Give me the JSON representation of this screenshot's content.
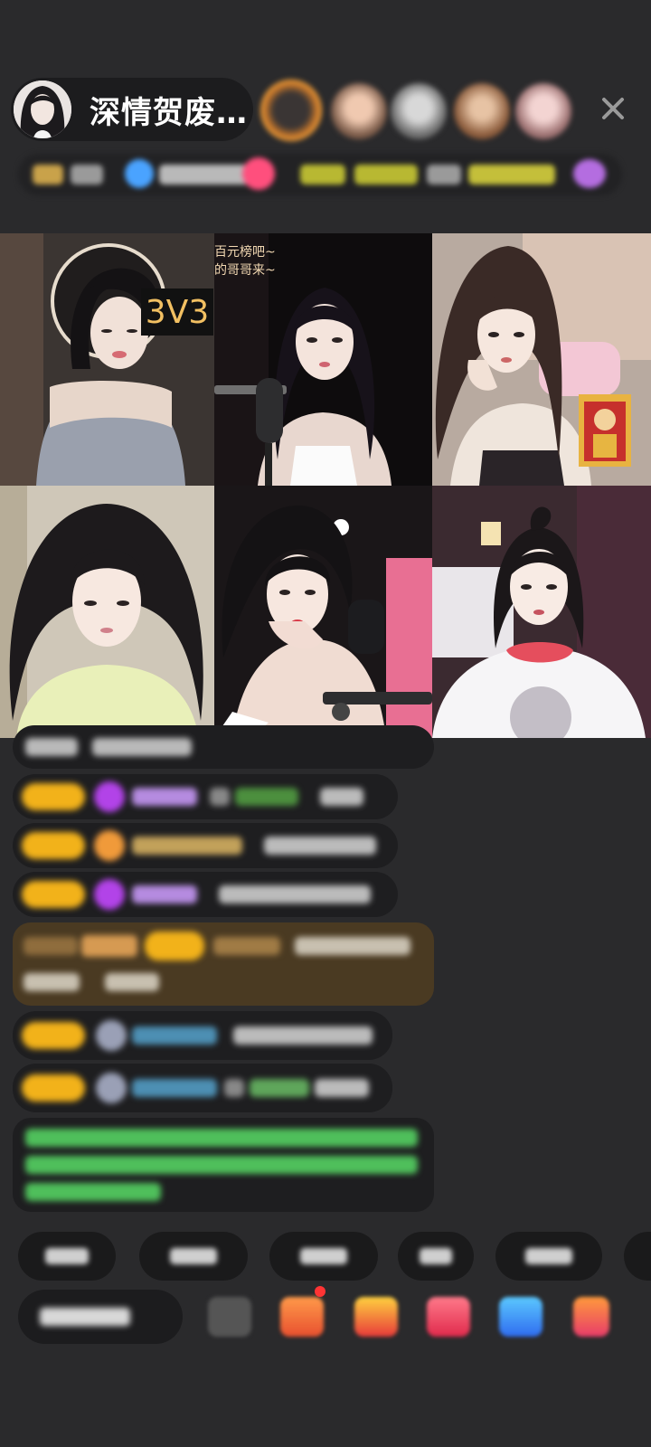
{
  "header": {
    "host_name": "深情贺废…",
    "close_label": "×"
  },
  "video_grid": {
    "battle_badge": "3V3",
    "overlay_line1": "百元榜吧~",
    "overlay_line2": "的哥哥来~"
  },
  "chat": {
    "messages": [
      {
        "type": "system"
      },
      {
        "type": "gift",
        "gem": "purple"
      },
      {
        "type": "gift",
        "gem": "orange"
      },
      {
        "type": "gift",
        "gem": "purple"
      },
      {
        "type": "highlight"
      },
      {
        "type": "gift",
        "gem": "gray"
      },
      {
        "type": "gift",
        "gem": "gray"
      },
      {
        "type": "notice"
      }
    ]
  },
  "colors": {
    "background": "#2a2a2c",
    "level_badge": "#f2b21a",
    "badge_text": "#f2c062",
    "notice_text": "#4fbf5b"
  },
  "icons": [
    "avatar-icon",
    "close-icon",
    "gift-icon",
    "share-icon",
    "more-icon"
  ]
}
